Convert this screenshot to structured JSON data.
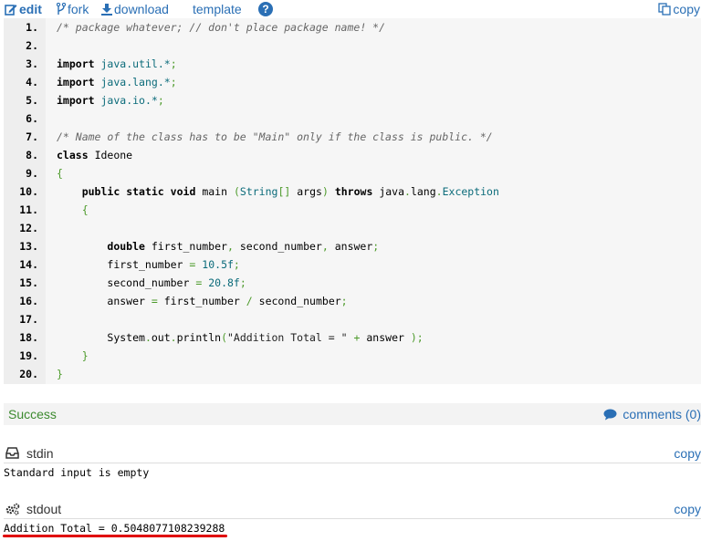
{
  "toolbar": {
    "edit": "edit",
    "fork": "fork",
    "download": "download",
    "template": "template",
    "help": "?",
    "copy": "copy"
  },
  "code_lines": [
    {
      "n": "1.",
      "text": "/* package whatever; // don't place package name! */"
    },
    {
      "n": "2.",
      "text": ""
    },
    {
      "n": "3.",
      "text": "import java.util.*;"
    },
    {
      "n": "4.",
      "text": "import java.lang.*;"
    },
    {
      "n": "5.",
      "text": "import java.io.*;"
    },
    {
      "n": "6.",
      "text": ""
    },
    {
      "n": "7.",
      "text": "/* Name of the class has to be \"Main\" only if the class is public. */"
    },
    {
      "n": "8.",
      "text": "class Ideone"
    },
    {
      "n": "9.",
      "text": "{"
    },
    {
      "n": "10.",
      "text": "    public static void main (String[] args) throws java.lang.Exception"
    },
    {
      "n": "11.",
      "text": "    {"
    },
    {
      "n": "12.",
      "text": ""
    },
    {
      "n": "13.",
      "text": "        double first_number, second_number, answer;"
    },
    {
      "n": "14.",
      "text": "        first_number = 10.5f;"
    },
    {
      "n": "15.",
      "text": "        second_number = 20.8f;"
    },
    {
      "n": "16.",
      "text": "        answer = first_number / second_number;"
    },
    {
      "n": "17.",
      "text": ""
    },
    {
      "n": "18.",
      "text": "        System.out.println(\"Addition Total = \" + answer );"
    },
    {
      "n": "19.",
      "text": "    }"
    },
    {
      "n": "20.",
      "text": "}"
    }
  ],
  "status": {
    "result": "Success",
    "comments": "comments (0)"
  },
  "stdin": {
    "title": "stdin",
    "copy": "copy",
    "content": "Standard input is empty"
  },
  "stdout": {
    "title": "stdout",
    "copy": "copy",
    "content": "Addition Total = 0.5048077108239288"
  },
  "colors": {
    "link": "#2a6fb5",
    "success": "#3c8a2e",
    "highlight_underline": "#e00000"
  }
}
